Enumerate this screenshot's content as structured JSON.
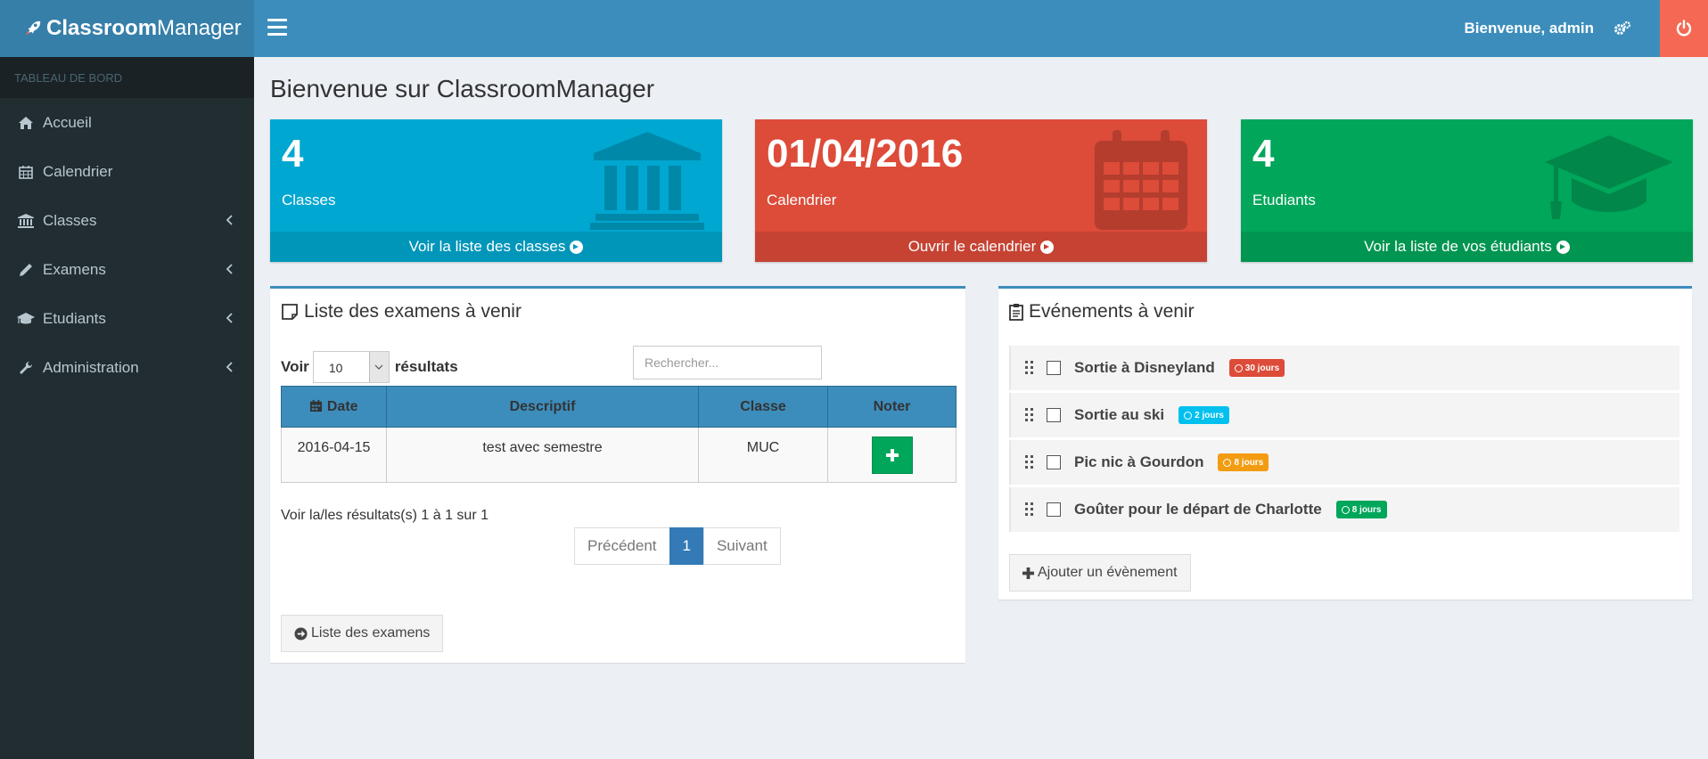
{
  "header": {
    "brand_bold": "Classroom",
    "brand_rest": "Manager",
    "welcome": "Bienvenue, admin"
  },
  "sidebar": {
    "section": "TABLEAU DE BORD",
    "items": [
      {
        "label": "Accueil",
        "icon": "home-icon"
      },
      {
        "label": "Calendrier",
        "icon": "calendar-icon"
      },
      {
        "label": "Classes",
        "icon": "institution-icon"
      },
      {
        "label": "Examens",
        "icon": "pencil-icon"
      },
      {
        "label": "Etudiants",
        "icon": "graduation-cap-icon"
      },
      {
        "label": "Administration",
        "icon": "wrench-icon"
      }
    ]
  },
  "page": {
    "title": "Bienvenue sur ClassroomManager"
  },
  "infoboxes": [
    {
      "value": "4",
      "label": "Classes",
      "link": "Voir la liste des classes",
      "color": "#00a7d0"
    },
    {
      "value": "01/04/2016",
      "label": "Calendrier",
      "link": "Ouvrir le calendrier",
      "color": "#dd4b39"
    },
    {
      "value": "4",
      "label": "Etudiants",
      "link": "Voir la liste de vos étudiants",
      "color": "#00a65a"
    }
  ],
  "exams": {
    "title": "Liste des examens à venir",
    "show_label": "Voir",
    "page_size": "10",
    "results_label": "résultats",
    "search_placeholder": "Rechercher...",
    "columns": [
      "Date",
      "Descriptif",
      "Classe",
      "Noter"
    ],
    "rows": [
      {
        "date": "2016-04-15",
        "desc": "test avec semestre",
        "classe": "MUC"
      }
    ],
    "info": "Voir la/les résultats(s) 1 à 1 sur 1",
    "prev": "Précédent",
    "page": "1",
    "next": "Suivant",
    "list_button": "Liste des examens"
  },
  "events": {
    "title": "Evénements à venir",
    "items": [
      {
        "label": "Sortie à Disneyland",
        "badge": "30 jours",
        "color": "#dd4b39"
      },
      {
        "label": "Sortie au ski",
        "badge": "2 jours",
        "color": "#00c0ef"
      },
      {
        "label": "Pic nic à Gourdon",
        "badge": "8 jours",
        "color": "#f39c12"
      },
      {
        "label": "Goûter pour le départ de Charlotte",
        "badge": "8 jours",
        "color": "#00a65a"
      }
    ],
    "add_button": "Ajouter un évènement"
  }
}
